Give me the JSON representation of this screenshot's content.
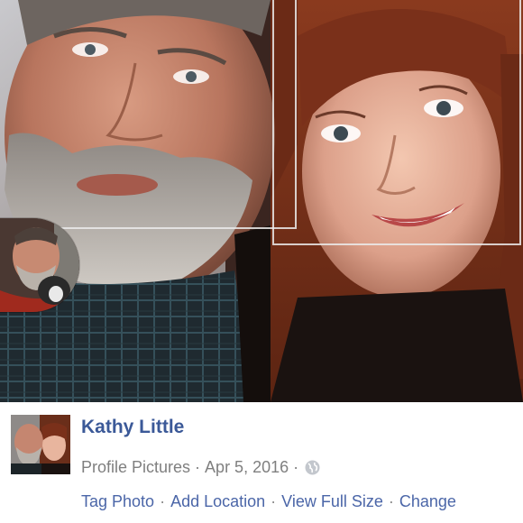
{
  "post": {
    "author_name": "Kathy Little",
    "album": "Profile Pictures",
    "separator": "·",
    "date": "Apr 5, 2016",
    "privacy_icon": "globe-icon"
  },
  "actions": [
    {
      "label": "Tag Photo"
    },
    {
      "label": "Add Location"
    },
    {
      "label": "View Full Size"
    },
    {
      "label": "Change"
    }
  ],
  "colors": {
    "name_link": "#3b5998",
    "action_link": "#4b66a8",
    "meta_text": "#7f7f7f"
  }
}
